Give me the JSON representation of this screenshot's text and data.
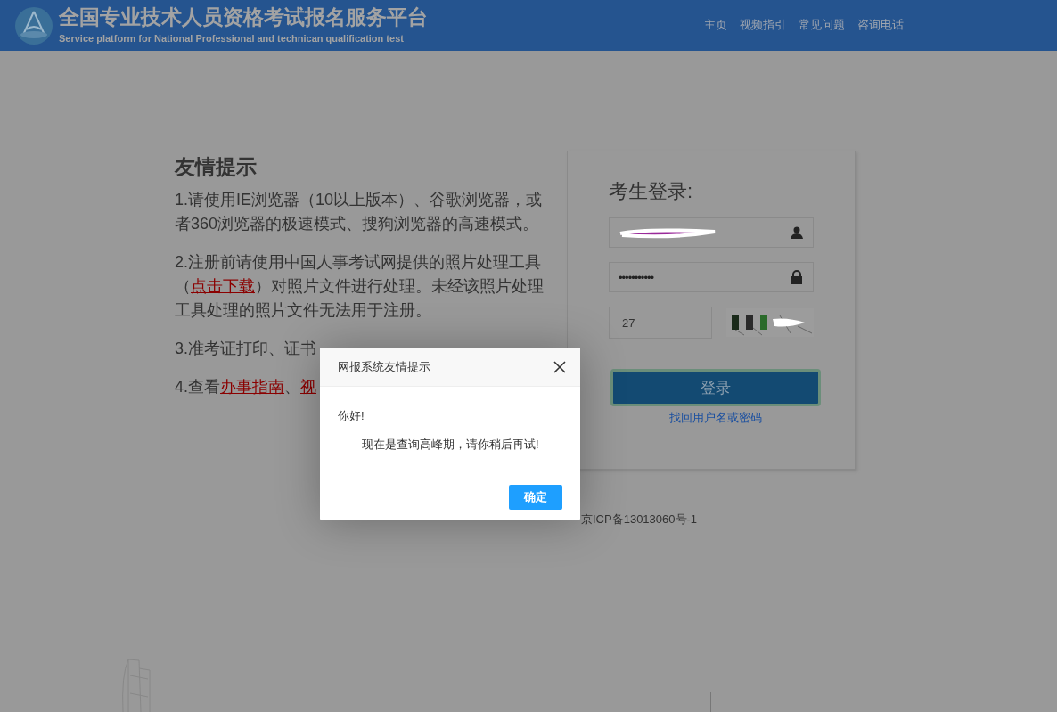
{
  "header": {
    "title": "全国专业技术人员资格考试报名服务平台",
    "subtitle": "Service platform for National Professional and technican qualification test",
    "nav": [
      {
        "label": "主页"
      },
      {
        "label": "视频指引"
      },
      {
        "label": "常见问题"
      },
      {
        "label": "咨询电话"
      }
    ]
  },
  "notice": {
    "heading": "友情提示",
    "items": [
      {
        "parts": [
          {
            "kind": "text",
            "text": "1.请使用IE浏览器（10以上版本）、谷歌浏览器，或者360浏览器的极速模式、搜狗浏览器的高速模式。"
          }
        ]
      },
      {
        "parts": [
          {
            "kind": "text",
            "text": "2.注册前请使用中国人事考试网提供的照片处理工具（"
          },
          {
            "kind": "link",
            "text": "点击下载"
          },
          {
            "kind": "text",
            "text": "）对照片文件进行处理。未经该照片处理工具处理的照片文件无法用于注册。"
          }
        ]
      },
      {
        "parts": [
          {
            "kind": "text",
            "text": "3.准考证打印、证书"
          }
        ]
      },
      {
        "parts": [
          {
            "kind": "text",
            "text": "4.查看"
          },
          {
            "kind": "link",
            "text": "办事指南"
          },
          {
            "kind": "text",
            "text": "、"
          },
          {
            "kind": "link",
            "text": "视"
          }
        ]
      }
    ]
  },
  "login": {
    "title": "考生登录:",
    "password": "•••••••••••",
    "captcha_value": "27",
    "button": "登录",
    "recover_link": "找回用户名或密码"
  },
  "footer": {
    "right": "京ICP备13013060号-1"
  },
  "dialog": {
    "title": "网报系统友情提示",
    "greeting": "你好!",
    "message": "现在是查询高峰期，请你稍后再试!",
    "ok": "确定"
  }
}
